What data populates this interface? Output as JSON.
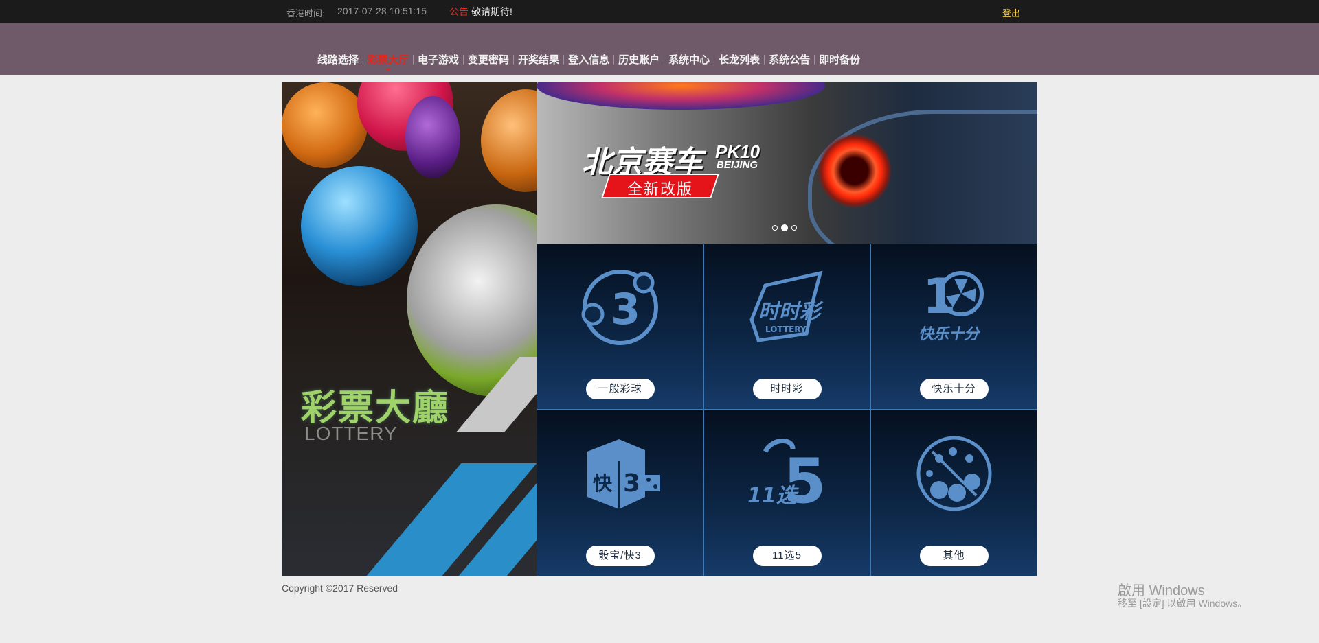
{
  "topbar": {
    "time_label": "香港时间:",
    "time": "2017-07-28 10:51:15",
    "notice_label": "公告",
    "notice": "敬请期待!",
    "logout": "登出"
  },
  "nav": [
    {
      "label": "线路选择"
    },
    {
      "label": "彩票大厅",
      "active": true
    },
    {
      "label": "电子游戏"
    },
    {
      "label": "变更密码"
    },
    {
      "label": "开奖结果"
    },
    {
      "label": "登入信息"
    },
    {
      "label": "历史账户"
    },
    {
      "label": "系统中心"
    },
    {
      "label": "长龙列表"
    },
    {
      "label": "系统公告"
    },
    {
      "label": "即时备份"
    }
  ],
  "hero": {
    "title": "彩票大廳",
    "subtitle": "LOTTERY"
  },
  "banner": {
    "title": "北京赛车",
    "title_suffix": "PK10",
    "title_sub": "BEIJING",
    "tag": "全新改版",
    "active_slide": 2,
    "slides": 3
  },
  "games": [
    {
      "label": "一般彩球",
      "icon": "ball-3-icon"
    },
    {
      "label": "时时彩",
      "icon": "ssc-lottery-icon"
    },
    {
      "label": "快乐十分",
      "icon": "happy-10-icon"
    },
    {
      "label": "骰宝/快3",
      "icon": "dice-k3-icon"
    },
    {
      "label": "11选5",
      "icon": "11x5-icon"
    },
    {
      "label": "其他",
      "icon": "other-balls-icon"
    }
  ],
  "footer": "Copyright ©2017 Reserved",
  "watermark": {
    "line1": "啟用 Windows",
    "line2": "移至 [設定] 以啟用 Windows。"
  }
}
